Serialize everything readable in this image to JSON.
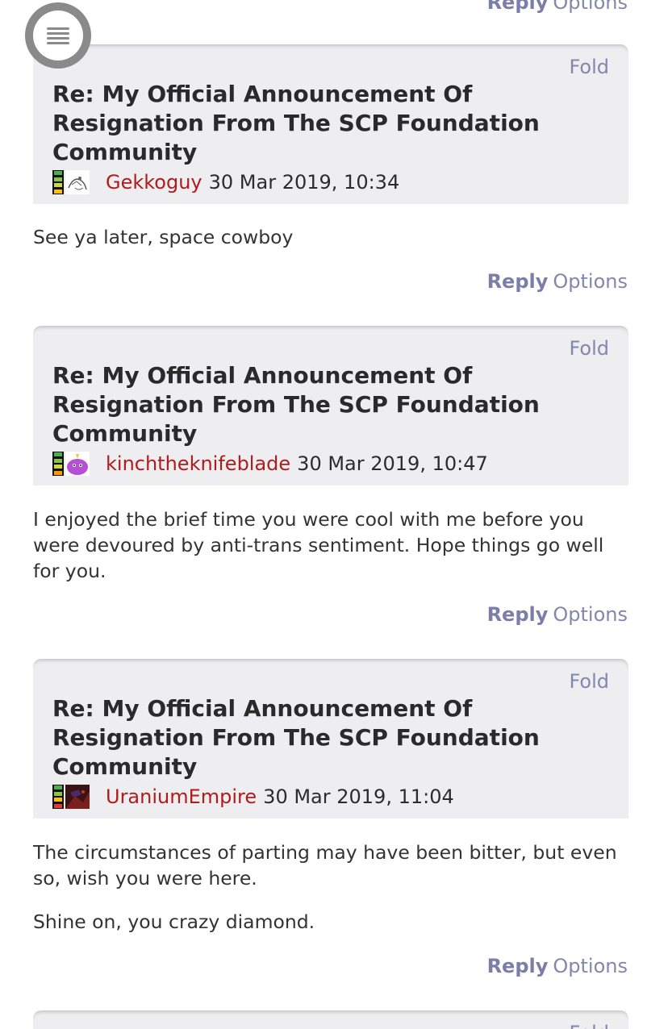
{
  "top_actions": {
    "reply": "Reply",
    "options": "Options"
  },
  "menu_button": {
    "icon": "hamburger-icon"
  },
  "posts": [
    {
      "fold": "Fold",
      "title": "Re: My Official Announcement Of Resignation From The SCP Foundation Community",
      "username": "Gekkoguy",
      "date": "30 Mar 2019, 10:34",
      "avatar": "sketch-avatar",
      "body": [
        "See ya later, space cowboy"
      ],
      "reply": "Reply",
      "options": "Options"
    },
    {
      "fold": "Fold",
      "title": "Re: My Official Announcement Of Resignation From The SCP Foundation Community",
      "username": "kinchtheknifeblade",
      "date": "30 Mar 2019, 10:47",
      "avatar": "purple-creature-avatar",
      "body": [
        "I enjoyed the brief time you were cool with me before you were devoured by anti-trans sentiment. Hope things go well for you."
      ],
      "reply": "Reply",
      "options": "Options"
    },
    {
      "fold": "Fold",
      "title": "Re: My Official Announcement Of Resignation From The SCP Foundation Community",
      "username": "UraniumEmpire",
      "date": "30 Mar 2019, 11:04",
      "avatar": "dark-red-avatar",
      "body": [
        "The circumstances of parting may have been bitter, but even so, wish you were here.",
        "Shine on, you crazy diamond."
      ],
      "reply": "Reply",
      "options": "Options"
    }
  ],
  "partial_post": {
    "fold": "Fold"
  },
  "colors": {
    "username": "#b01c1c",
    "link": "#7b7fa8",
    "header_bg": "#eeedf0",
    "text": "#333333"
  }
}
